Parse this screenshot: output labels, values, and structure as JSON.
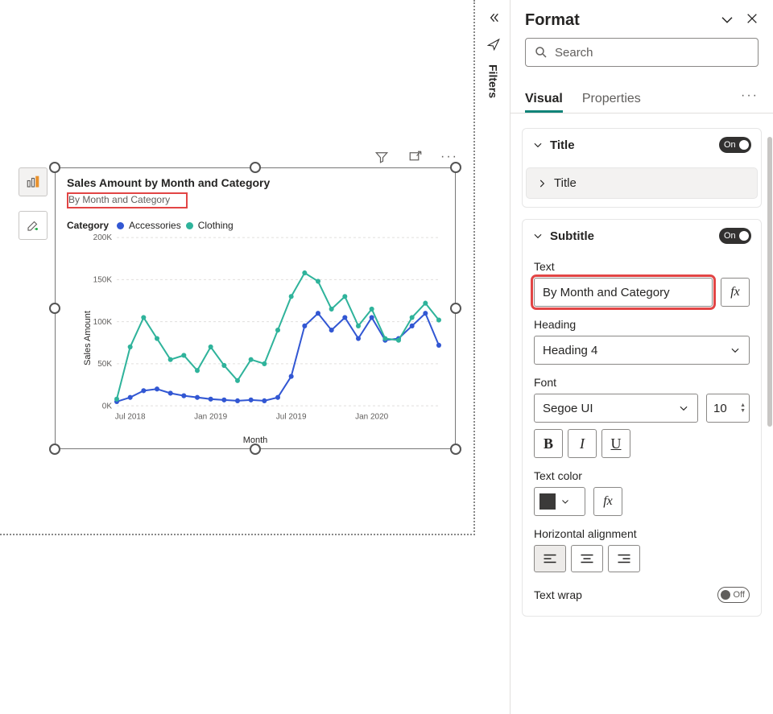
{
  "pane": {
    "title": "Format",
    "search_placeholder": "Search",
    "tabs": {
      "visual": "Visual",
      "properties": "Properties"
    }
  },
  "filters_label": "Filters",
  "sections": {
    "title": {
      "label": "Title",
      "state": "On",
      "sub_label": "Title"
    },
    "subtitle": {
      "label": "Subtitle",
      "state": "On",
      "text_label": "Text",
      "text_value": "By Month and Category",
      "heading_label": "Heading",
      "heading_value": "Heading 4",
      "font_label": "Font",
      "font_value": "Segoe UI",
      "font_size": "10",
      "color_label": "Text color",
      "color_value": "#3b3a39",
      "align_label": "Horizontal alignment",
      "wrap_label": "Text wrap",
      "wrap_state": "Off"
    }
  },
  "chart": {
    "title": "Sales Amount by Month and Category",
    "subtitle": "By Month and Category",
    "legend_label": "Category",
    "legend_series": [
      "Accessories",
      "Clothing"
    ],
    "y_title": "Sales Amount",
    "x_title": "Month"
  },
  "chart_data": {
    "type": "line",
    "xlabel": "Month",
    "ylabel": "Sales Amount",
    "ylim": [
      0,
      200000
    ],
    "y_ticks": [
      "0K",
      "50K",
      "100K",
      "150K",
      "200K"
    ],
    "x_ticks": [
      "Jul 2018",
      "Jan 2019",
      "Jul 2019",
      "Jan 2020"
    ],
    "title": "Sales Amount by Month and Category",
    "categories": [
      "2018-06",
      "2018-07",
      "2018-08",
      "2018-09",
      "2018-10",
      "2018-11",
      "2018-12",
      "2019-01",
      "2019-02",
      "2019-03",
      "2019-04",
      "2019-05",
      "2019-06",
      "2019-07",
      "2019-08",
      "2019-09",
      "2019-10",
      "2019-11",
      "2019-12",
      "2020-01",
      "2020-02",
      "2020-03",
      "2020-04",
      "2020-05",
      "2020-06"
    ],
    "series": [
      {
        "name": "Accessories",
        "color": "#3257d3",
        "values": [
          5000,
          10000,
          18000,
          20000,
          15000,
          12000,
          10000,
          8000,
          7000,
          6000,
          7000,
          6000,
          10000,
          35000,
          95000,
          110000,
          90000,
          105000,
          80000,
          105000,
          78000,
          80000,
          95000,
          110000,
          72000
        ]
      },
      {
        "name": "Clothing",
        "color": "#2fb39b",
        "values": [
          8000,
          70000,
          105000,
          80000,
          55000,
          60000,
          42000,
          70000,
          48000,
          30000,
          55000,
          50000,
          90000,
          130000,
          158000,
          148000,
          115000,
          130000,
          95000,
          115000,
          80000,
          78000,
          105000,
          122000,
          102000
        ]
      }
    ]
  }
}
